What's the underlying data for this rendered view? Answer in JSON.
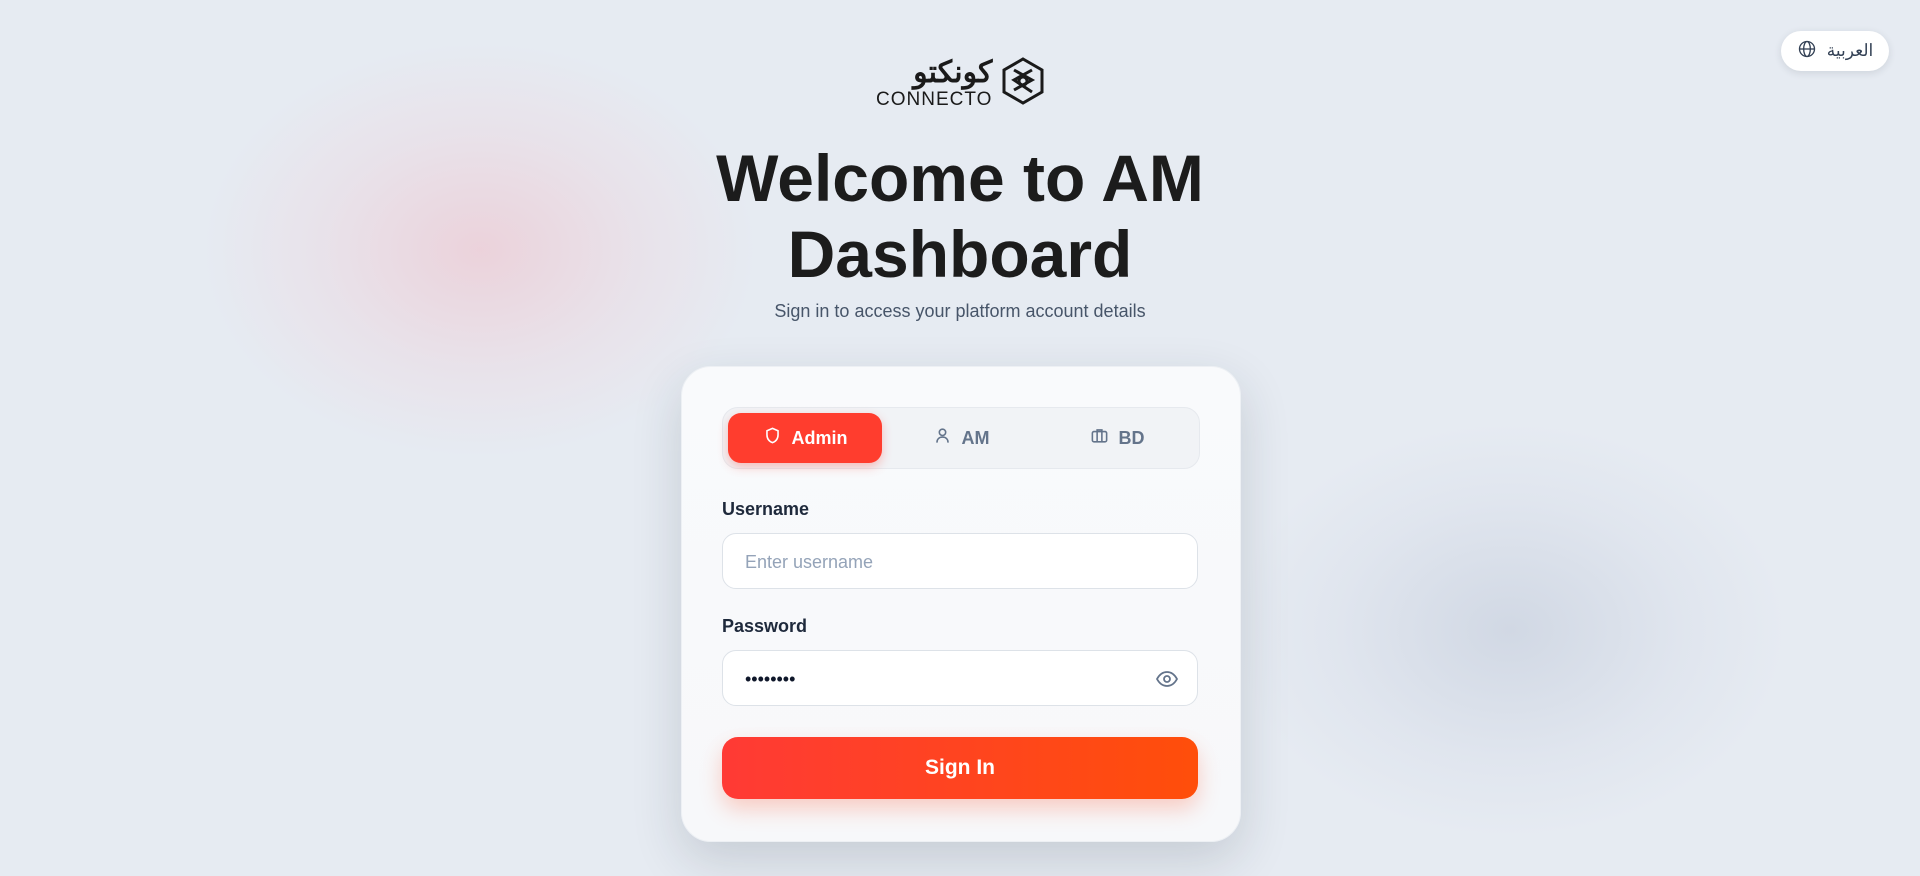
{
  "language_toggle": {
    "label": "العربية",
    "icon": "globe-icon"
  },
  "logo": {
    "arabic": "كونكتو",
    "latin": "CONNECTO"
  },
  "heading": {
    "line1": "Welcome to AM",
    "line2": "Dashboard"
  },
  "subtitle": "Sign in to access your platform account details",
  "role_tabs": [
    {
      "label": "Admin",
      "icon": "shield-icon",
      "active": true
    },
    {
      "label": "AM",
      "icon": "user-icon",
      "active": false
    },
    {
      "label": "BD",
      "icon": "briefcase-icon",
      "active": false
    }
  ],
  "username": {
    "label": "Username",
    "placeholder": "Enter username",
    "value": ""
  },
  "password": {
    "label": "Password",
    "value": "••••••••",
    "toggle_icon": "eye-icon"
  },
  "signin_label": "Sign In",
  "colors": {
    "accent": "#ff3d2e",
    "accent_end": "#ff4e0a",
    "text": "#1c1c1c",
    "muted": "#64748b"
  }
}
